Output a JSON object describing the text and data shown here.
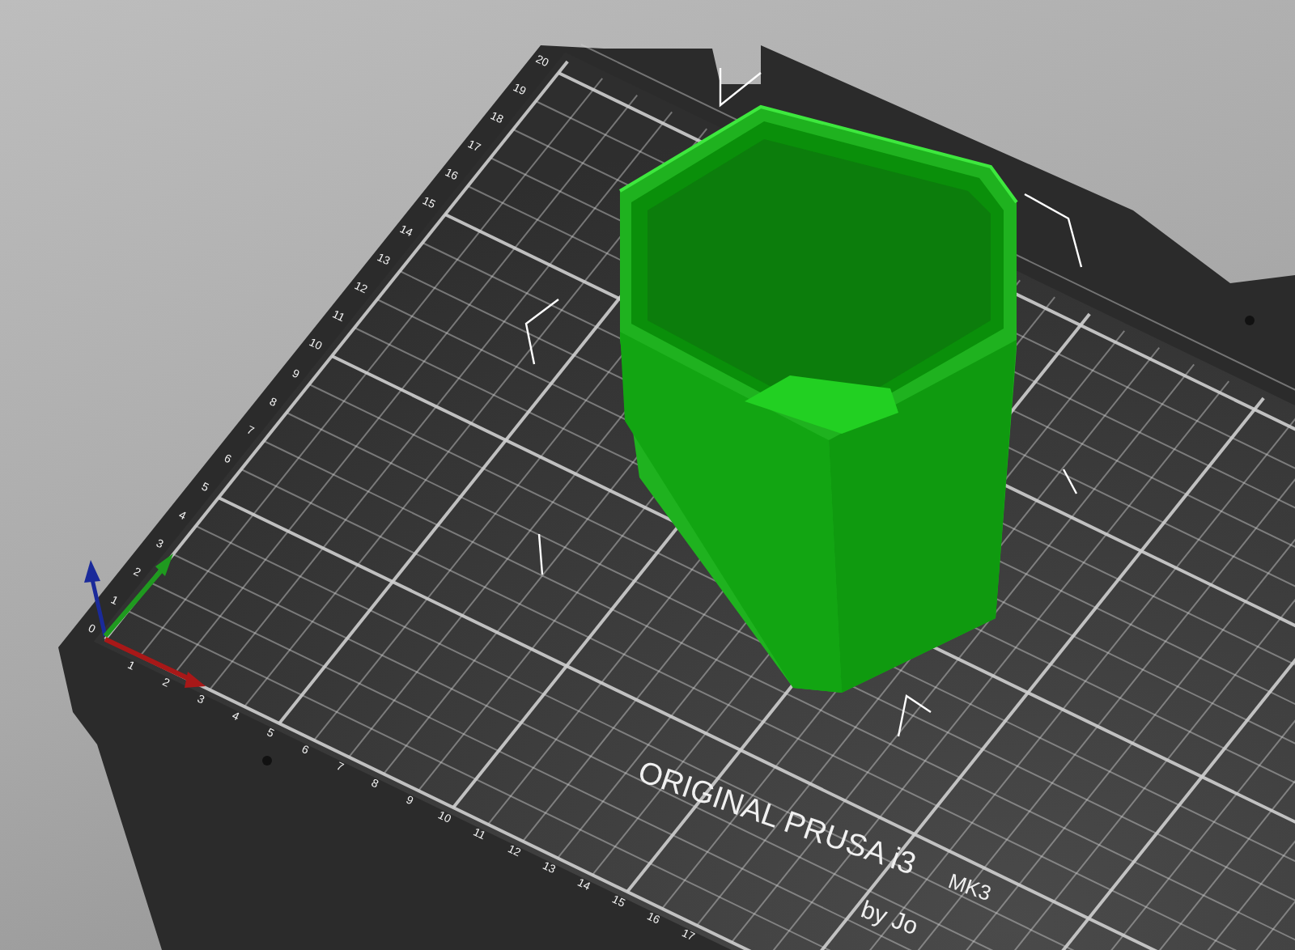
{
  "scene": {
    "bed_label": {
      "title": "ORIGINAL PRUSA i3",
      "model": "MK3",
      "byline": "by Jo"
    },
    "x_ticks": [
      "1",
      "2",
      "3",
      "4",
      "5",
      "6",
      "7",
      "8",
      "9",
      "10",
      "11",
      "12",
      "13",
      "14",
      "15",
      "16",
      "17"
    ],
    "y_ticks": [
      "0",
      "1",
      "2",
      "3",
      "4",
      "5",
      "6",
      "7",
      "8",
      "9",
      "10",
      "11",
      "12",
      "13",
      "14",
      "15",
      "16",
      "17",
      "18",
      "19",
      "20"
    ]
  }
}
